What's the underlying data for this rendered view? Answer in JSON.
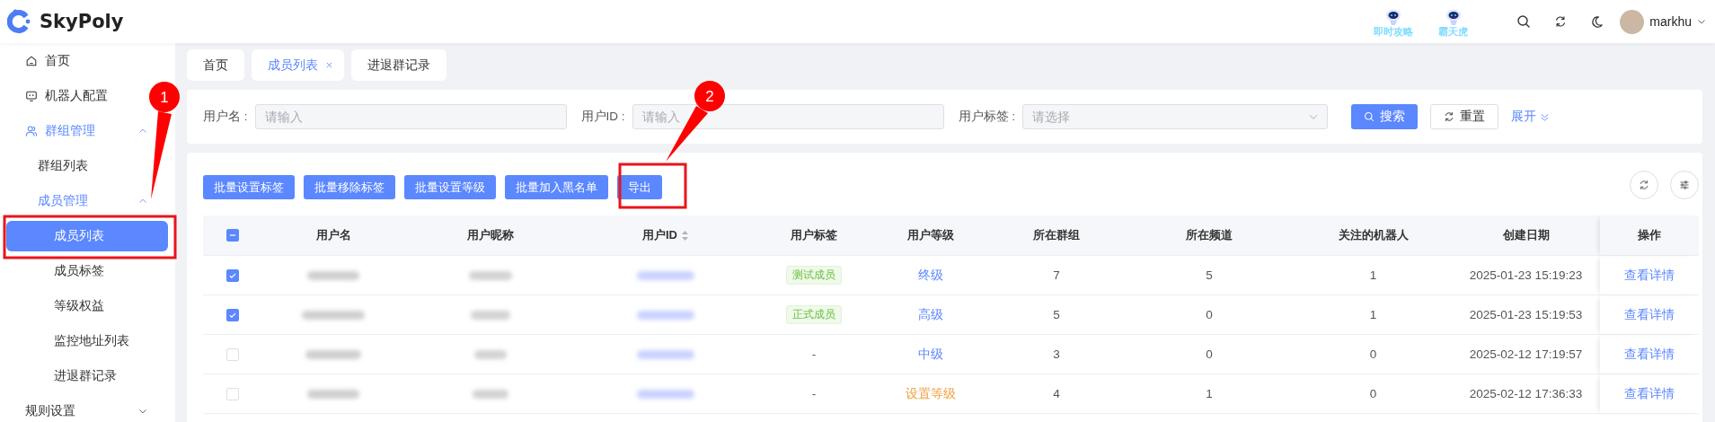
{
  "header": {
    "brand": "SkyPoly",
    "promos": [
      {
        "label": "即时攻略"
      },
      {
        "label": "霸天虎"
      }
    ],
    "user": {
      "name": "markhu"
    }
  },
  "sidebar": {
    "items": [
      {
        "label": "首页",
        "selected": false,
        "highlighted": false
      },
      {
        "label": "机器人配置",
        "selected": false,
        "highlighted": false
      },
      {
        "label": "群组管理",
        "selected": false,
        "highlighted": true,
        "expanded": true,
        "children": [
          {
            "label": "群组列表",
            "selected": false,
            "highlighted": false
          },
          {
            "label": "成员管理",
            "selected": false,
            "highlighted": true,
            "expanded": true,
            "children": [
              {
                "label": "成员列表",
                "selected": true,
                "highlighted": false
              },
              {
                "label": "成员标签",
                "selected": false,
                "highlighted": false
              },
              {
                "label": "等级权益",
                "selected": false,
                "highlighted": false
              },
              {
                "label": "监控地址列表",
                "selected": false,
                "highlighted": false
              },
              {
                "label": "进退群记录",
                "selected": false,
                "highlighted": false
              }
            ]
          }
        ]
      },
      {
        "label": "规则设置",
        "selected": false,
        "highlighted": false,
        "expanded": false
      }
    ]
  },
  "tabs": [
    {
      "label": "首页",
      "selected": false,
      "closable": false
    },
    {
      "label": "成员列表",
      "selected": true,
      "closable": true
    },
    {
      "label": "进退群记录",
      "selected": false,
      "closable": false
    }
  ],
  "filters": {
    "fields": [
      {
        "label": "用户名 :",
        "placeholder": "请输入",
        "kind": "input"
      },
      {
        "label": "用户ID :",
        "placeholder": "请输入",
        "kind": "input"
      },
      {
        "label": "用户标签 :",
        "placeholder": "请选择",
        "kind": "select"
      }
    ],
    "search": "搜索",
    "reset": "重置",
    "expand": "展开"
  },
  "toolbar": {
    "buttons": [
      "批量设置标签",
      "批量移除标签",
      "批量设置等级",
      "批量加入黑名单",
      "导出"
    ]
  },
  "table": {
    "header_checkbox": {
      "indeterminate": true
    },
    "columns": [
      {
        "label": "用户名",
        "sortable": false
      },
      {
        "label": "用户昵称",
        "sortable": false
      },
      {
        "label": "用户ID",
        "sortable": true
      },
      {
        "label": "用户标签",
        "sortable": false
      },
      {
        "label": "用户等级",
        "sortable": false
      },
      {
        "label": "所在群组",
        "sortable": false
      },
      {
        "label": "所在频道",
        "sortable": false
      },
      {
        "label": "关注的机器人",
        "sortable": false
      },
      {
        "label": "创建日期",
        "sortable": false
      },
      {
        "label": "操作",
        "sortable": false
      }
    ],
    "rows": [
      {
        "selected": true,
        "tag": {
          "label": "测试成员",
          "kind": "badge"
        },
        "level": {
          "label": "终级",
          "kind": "set"
        },
        "groups": "7",
        "channels": "5",
        "bots": "1",
        "created": "2025-01-23 15:19:23",
        "action": "查看详情"
      },
      {
        "selected": true,
        "tag": {
          "label": "正式成员",
          "kind": "badge"
        },
        "level": {
          "label": "高级",
          "kind": "set"
        },
        "groups": "5",
        "channels": "0",
        "bots": "1",
        "created": "2025-01-23 15:19:53",
        "action": "查看详情"
      },
      {
        "selected": false,
        "tag": {
          "label": "-",
          "kind": "plain"
        },
        "level": {
          "label": "中级",
          "kind": "set"
        },
        "groups": "3",
        "channels": "0",
        "bots": "0",
        "created": "2025-02-12 17:19:57",
        "action": "查看详情"
      },
      {
        "selected": false,
        "tag": {
          "label": "-",
          "kind": "plain"
        },
        "level": {
          "label": "设置等级",
          "kind": "unset"
        },
        "groups": "4",
        "channels": "1",
        "bots": "0",
        "created": "2025-02-12 17:36:33",
        "action": "查看详情"
      }
    ]
  },
  "annotations": [
    {
      "number": "1"
    },
    {
      "number": "2"
    }
  ]
}
